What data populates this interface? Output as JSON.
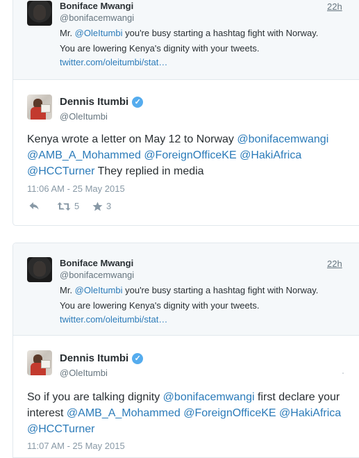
{
  "thread_1": {
    "quoted": {
      "name": "Boniface Mwangi",
      "handle": "@bonifacemwangi",
      "time": "22h",
      "line1_prefix": "Mr. ",
      "line1_mention": "@OleItumbi",
      "line1_suffix": " you're busy starting a hashtag fight with Norway.",
      "line2": "You are lowering Kenya's dignity with your tweets.",
      "link": "twitter.com/oleitumbi/stat…"
    },
    "reply": {
      "name": "Dennis Itumbi",
      "verified_glyph": "✓",
      "handle": "@OleItumbi",
      "line1_text": "Kenya wrote a letter on May 12 to Norway ",
      "line1_mention": "@bonifacemwangi",
      "line2_mention1": "@AMB_A_Mohammed",
      "line2_mention2": "@ForeignOfficeKE",
      "line2_mention3": "@HakiAfrica",
      "line3_mention": "@HCCTurner",
      "line3_text": " They replied in media",
      "timestamp": "11:06 AM - 25 May 2015",
      "retweet_count": "5",
      "favorite_count": "3"
    }
  },
  "thread_2": {
    "quoted": {
      "name": "Boniface Mwangi",
      "handle": "@bonifacemwangi",
      "time": "22h",
      "line1_prefix": "Mr. ",
      "line1_mention": "@OleItumbi",
      "line1_suffix": " you're busy starting a hashtag fight with Norway.",
      "line2": "You are lowering Kenya's dignity with your tweets.",
      "link": "twitter.com/oleitumbi/stat…"
    },
    "reply": {
      "name": "Dennis Itumbi",
      "verified_glyph": "✓",
      "handle": "@OleItumbi",
      "line1_text": "So if you are talking dignity ",
      "line1_mention": "@bonifacemwangi",
      "line1_suffix": " first declare your",
      "line2_text": "interest ",
      "line2_mention1": "@AMB_A_Mohammed",
      "line2_mention2": "@ForeignOfficeKE",
      "line2_mention3": "@HakiAfrica",
      "line3_mention": "@HCCTurner",
      "timestamp": "11:07 AM - 25 May 2015"
    }
  },
  "icons": {
    "reply": "reply-icon",
    "retweet": "retweet-icon",
    "favorite": "star-icon",
    "verified": "verified-badge-icon"
  },
  "colors": {
    "link": "#2b7bb9",
    "verified": "#55acee",
    "muted": "#8899a6",
    "quote_bg": "#f5f8fa",
    "border": "#e1e8ed"
  }
}
